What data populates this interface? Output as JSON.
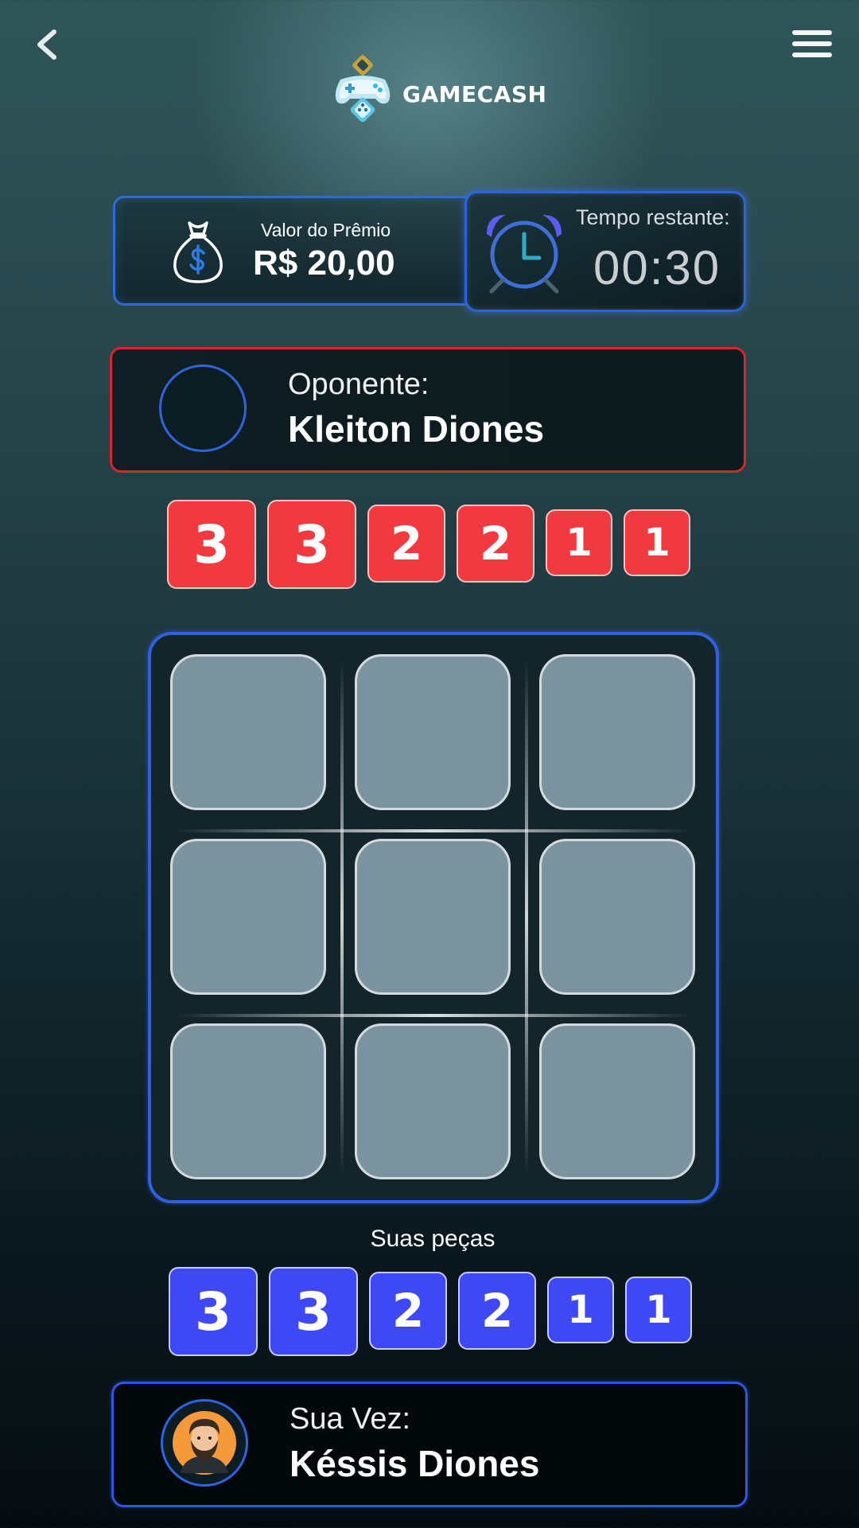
{
  "header": {
    "back_icon": "chevron-left-icon",
    "menu_icon": "hamburger-menu-icon",
    "logo_text": "GAMECASH"
  },
  "prize": {
    "label": "Valor do Prêmio",
    "value": "R$ 20,00",
    "icon": "money-bag-icon"
  },
  "timer": {
    "label": "Tempo restante:",
    "value": "00:30",
    "icon": "alarm-clock-icon"
  },
  "opponent": {
    "role": "Oponente:",
    "name": "Kleiton Diones",
    "color": "#d6262b",
    "pieces": [
      "3",
      "3",
      "2",
      "2",
      "1",
      "1"
    ],
    "piece_color": "#f03a40"
  },
  "board": {
    "cells": [
      "",
      "",
      "",
      "",
      "",
      "",
      "",
      "",
      ""
    ]
  },
  "player": {
    "pieces_label": "Suas peças",
    "pieces": [
      "3",
      "3",
      "2",
      "2",
      "1",
      "1"
    ],
    "piece_color": "#3f48f5",
    "role": "Sua Vez:",
    "name": "Késsis Diones",
    "color": "#2d55e6"
  }
}
